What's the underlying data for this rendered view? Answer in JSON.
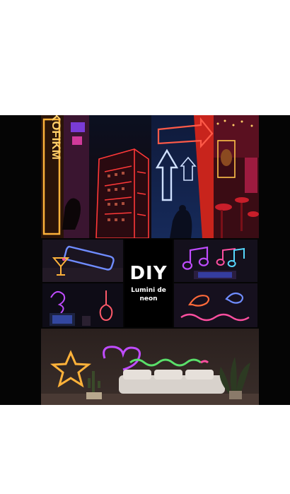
{
  "poster": {
    "title": "DIY",
    "subtitle": "Lumini de neon"
  },
  "photo_signs": {
    "vertical_sign_text": "MIKOFIKM"
  },
  "colors": {
    "background": "#ffffff",
    "collage_bg": "#050505",
    "neon_blue": "#5a7cff",
    "neon_pink": "#ff3fa8",
    "neon_orange": "#ff8a2a",
    "neon_red": "#ff3030",
    "neon_purple": "#b04cff"
  }
}
